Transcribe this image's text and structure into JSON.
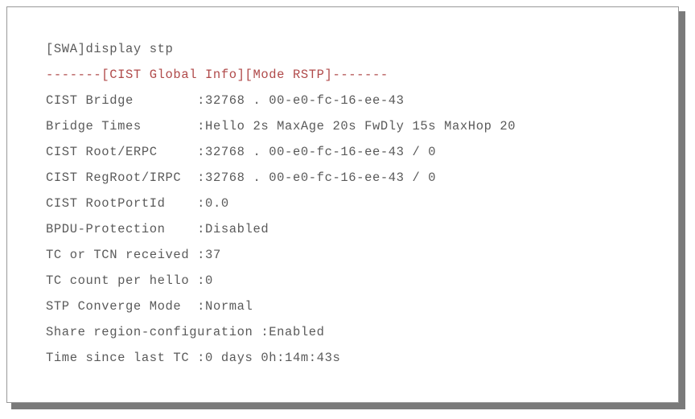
{
  "window": {
    "title": "display stp output",
    "frame_border_color": "#999999",
    "shadow_color": "#7a7a7a",
    "background_color": "#ffffff"
  },
  "terminal": {
    "text_color": "#5a5a5a",
    "accent_color": "#b04a4a",
    "prompt_line": "[SWA]display stp",
    "banner_line": "-------[CIST Global Info][Mode RSTP]-------",
    "rows": [
      {
        "label": "CIST Bridge        ",
        "value": ":32768 . 00-e0-fc-16-ee-43"
      },
      {
        "label": "Bridge Times       ",
        "value": ":Hello 2s MaxAge 20s FwDly 15s MaxHop 20"
      },
      {
        "label": "CIST Root/ERPC     ",
        "value": ":32768 . 00-e0-fc-16-ee-43 / 0"
      },
      {
        "label": "CIST RegRoot/IRPC  ",
        "value": ":32768 . 00-e0-fc-16-ee-43 / 0"
      },
      {
        "label": "CIST RootPortId    ",
        "value": ":0.0"
      },
      {
        "label": "BPDU-Protection    ",
        "value": ":Disabled"
      },
      {
        "label": "TC or TCN received ",
        "value": ":37"
      },
      {
        "label": "TC count per hello ",
        "value": ":0"
      },
      {
        "label": "STP Converge Mode  ",
        "value": ":Normal"
      },
      {
        "label": "Share region-configuration ",
        "value": ":Enabled"
      },
      {
        "label": "Time since last TC ",
        "value": ":0 days 0h:14m:43s"
      }
    ]
  }
}
